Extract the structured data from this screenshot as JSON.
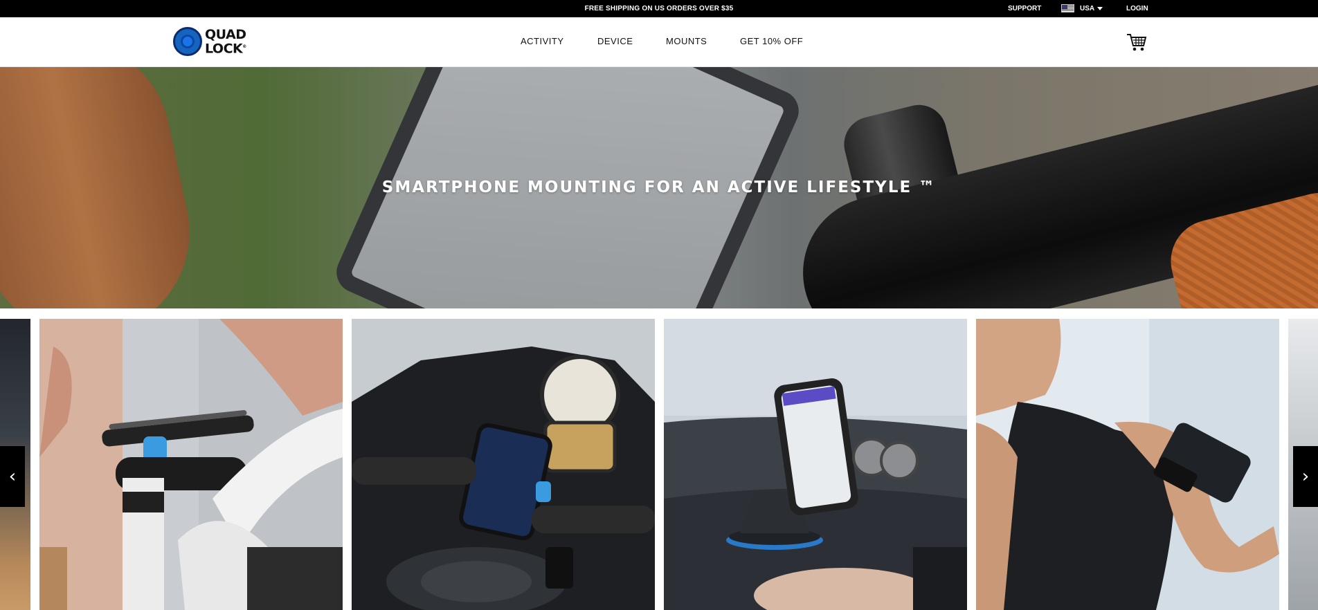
{
  "topbar": {
    "promo": "FREE SHIPPING ON US ORDERS OVER $35",
    "support": "SUPPORT",
    "region": "USA",
    "login": "LOGIN"
  },
  "header": {
    "logo_line1": "QUAD",
    "logo_line2": "LOCK",
    "logo_mark": "®",
    "nav": [
      {
        "label": "ACTIVITY"
      },
      {
        "label": "DEVICE"
      },
      {
        "label": "MOUNTS"
      },
      {
        "label": "GET 10% OFF"
      }
    ],
    "cart_icon": "shopping-cart-icon"
  },
  "hero": {
    "title": "SMARTPHONE MOUNTING FOR AN ACTIVE LIFESTYLE ™"
  },
  "carousel": {
    "prev_label": "‹",
    "next_label": "›",
    "tiles": [
      {
        "name": "partial-left-tile"
      },
      {
        "name": "bike-mount-tile"
      },
      {
        "name": "motorcycle-mount-tile"
      },
      {
        "name": "car-mount-tile"
      },
      {
        "name": "running-armband-tile"
      },
      {
        "name": "partial-right-tile"
      }
    ]
  },
  "colors": {
    "topbar_bg": "#000000",
    "brand_blue": "#1565c0",
    "accent_blue": "#3aa0e8"
  }
}
